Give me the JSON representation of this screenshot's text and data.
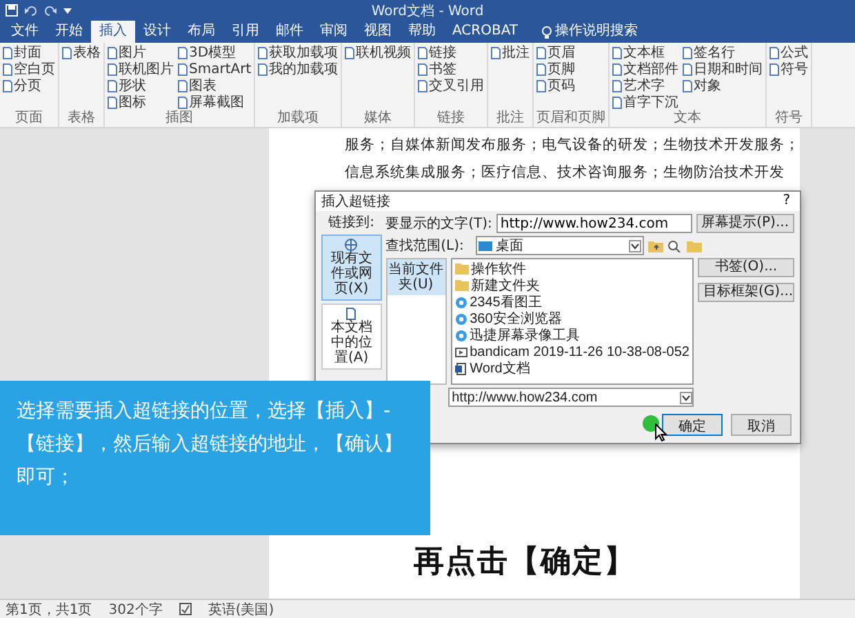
{
  "window": {
    "title": "Word文档 - Word"
  },
  "tabs": [
    {
      "label": "文件",
      "selected": false
    },
    {
      "label": "开始",
      "selected": false
    },
    {
      "label": "插入",
      "selected": true
    },
    {
      "label": "设计",
      "selected": false
    },
    {
      "label": "布局",
      "selected": false
    },
    {
      "label": "引用",
      "selected": false
    },
    {
      "label": "邮件",
      "selected": false
    },
    {
      "label": "审阅",
      "selected": false
    },
    {
      "label": "视图",
      "selected": false
    },
    {
      "label": "帮助",
      "selected": false
    },
    {
      "label": "ACROBAT",
      "selected": false
    }
  ],
  "search": {
    "label": "操作说明搜索"
  },
  "ribbon": {
    "groups": [
      {
        "label": "页面",
        "items": [
          "封面",
          "空白页",
          "分页"
        ]
      },
      {
        "label": "表格",
        "items": [
          "表格"
        ]
      },
      {
        "label": "插图",
        "items": [
          "图片",
          "联机图片",
          "形状",
          "图标",
          "3D模型",
          "SmartArt",
          "图表",
          "屏幕截图"
        ]
      },
      {
        "label": "加载项",
        "items": [
          "获取加载项",
          "我的加载项"
        ]
      },
      {
        "label": "媒体",
        "items": [
          "联机视频"
        ]
      },
      {
        "label": "链接",
        "items": [
          "链接",
          "书签",
          "交叉引用"
        ]
      },
      {
        "label": "批注",
        "items": [
          "批注"
        ]
      },
      {
        "label": "页眉和页脚",
        "items": [
          "页眉",
          "页脚",
          "页码"
        ]
      },
      {
        "label": "文本",
        "items": [
          "文本框",
          "文档部件",
          "艺术字",
          "首字下沉",
          "签名行",
          "日期和时间",
          "对象"
        ]
      },
      {
        "label": "符号",
        "items": [
          "公式",
          "符号"
        ]
      }
    ]
  },
  "document": {
    "lines": [
      "服务；自媒体新闻发布服务；电气设备的研发；生物技术开发服务；",
      "信息系统集成服务；医疗信息、技术咨询服务；生物防治技术开发"
    ]
  },
  "dialog": {
    "title": "插入超链接",
    "help": "?",
    "link_to_label": "链接到:",
    "link_to": [
      {
        "label": "现有文件或网页(X)",
        "selected": true
      },
      {
        "label": "本文档中的位置(A)",
        "selected": false
      }
    ],
    "display_text_label": "要显示的文字(T):",
    "display_text": "http://www.how234.com",
    "screentip_button": "屏幕提示(P)...",
    "look_in_label": "查找范围(L):",
    "look_in": "桌面",
    "sources": [
      {
        "label": "当前文件夹(U)",
        "selected": true
      }
    ],
    "files": [
      {
        "name": "操作软件",
        "kind": "folder"
      },
      {
        "name": "新建文件夹",
        "kind": "folder"
      },
      {
        "name": "2345看图王",
        "kind": "app"
      },
      {
        "name": "360安全浏览器",
        "kind": "app"
      },
      {
        "name": "迅捷屏幕录像工具",
        "kind": "app"
      },
      {
        "name": "bandicam 2019-11-26 10-38-08-052",
        "kind": "video"
      },
      {
        "name": "Word文档",
        "kind": "document"
      }
    ],
    "side_buttons": [
      "书签(O)...",
      "目标框架(G)..."
    ],
    "address": "http://www.how234.com",
    "buttons": [
      "确定",
      "取消"
    ]
  },
  "caption": {
    "text": "选择需要插入超链接的位置，选择【插入】-【链接】，然后输入超链接的地址，【确认】即可；"
  },
  "subtitle": "再点击【确定】",
  "status_bar": {
    "page": "第1页，共1页",
    "words": "302个字",
    "language": "英语(美国)"
  }
}
